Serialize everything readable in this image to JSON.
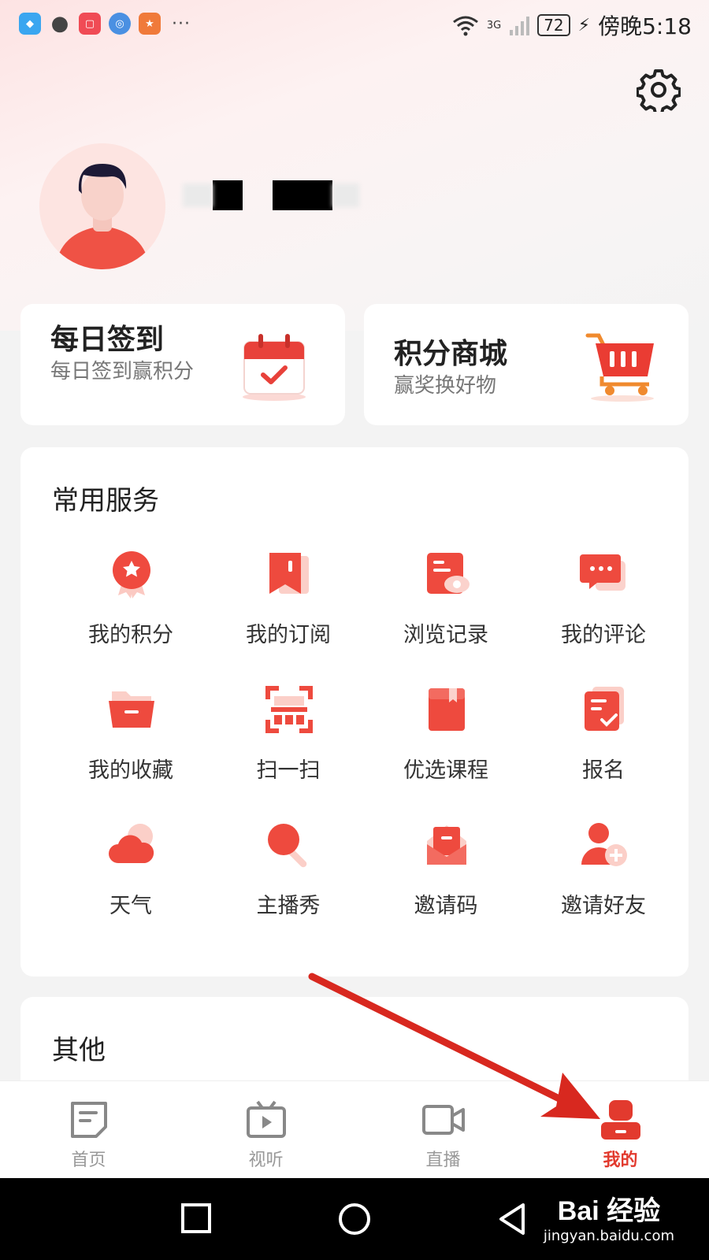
{
  "status_bar": {
    "network": "3G",
    "battery": "72",
    "time": "傍晚5:18"
  },
  "daily_checkin": {
    "title": "每日签到",
    "subtitle": "每日签到赢积分"
  },
  "points_mall": {
    "title": "积分商城",
    "subtitle": "赢奖换好物"
  },
  "common_services": {
    "title": "常用服务",
    "items": [
      {
        "label": "我的积分",
        "icon": "medal-icon"
      },
      {
        "label": "我的订阅",
        "icon": "bookmark-icon"
      },
      {
        "label": "浏览记录",
        "icon": "history-icon"
      },
      {
        "label": "我的评论",
        "icon": "comment-icon"
      },
      {
        "label": "我的收藏",
        "icon": "folder-icon"
      },
      {
        "label": "扫一扫",
        "icon": "scan-icon"
      },
      {
        "label": "优选课程",
        "icon": "course-icon"
      },
      {
        "label": "报名",
        "icon": "signup-icon"
      },
      {
        "label": "天气",
        "icon": "weather-icon"
      },
      {
        "label": "主播秀",
        "icon": "microphone-icon"
      },
      {
        "label": "邀请码",
        "icon": "invite-code-icon"
      },
      {
        "label": "邀请好友",
        "icon": "invite-friend-icon"
      }
    ]
  },
  "other_section": {
    "title": "其他"
  },
  "tabs": [
    {
      "label": "首页",
      "icon": "home-doc-icon"
    },
    {
      "label": "视听",
      "icon": "video-play-icon"
    },
    {
      "label": "直播",
      "icon": "live-camera-icon"
    },
    {
      "label": "我的",
      "icon": "profile-icon",
      "active": true
    }
  ],
  "watermark": {
    "brand": "Bai 经验",
    "url": "jingyan.baidu.com"
  },
  "colors": {
    "accent": "#e23a2e",
    "icon_red": "#f0483e",
    "icon_light": "#fbd2cc"
  }
}
